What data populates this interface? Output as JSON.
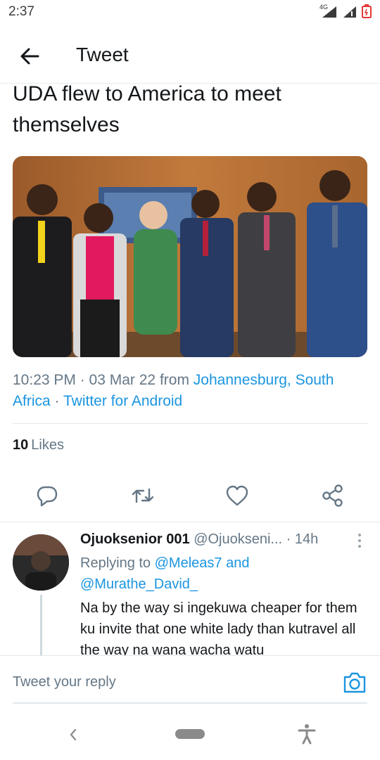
{
  "status_bar": {
    "time": "2:37",
    "network": "4G"
  },
  "header": {
    "title": "Tweet"
  },
  "tweet": {
    "text": "UDA flew to America to meet themselves",
    "timestamp": "10:23 PM · 03 Mar 22",
    "from_word": "from",
    "location": "Johannesburg, South Africa",
    "separator": "·",
    "client": "Twitter for Android",
    "likes_count": "10",
    "likes_label": "Likes"
  },
  "actions": [
    "reply-icon",
    "retweet-icon",
    "like-icon",
    "share-icon"
  ],
  "reply": {
    "name": "Ojuoksenior 001",
    "handle": "@Ojuokseni...",
    "time": "· 14h",
    "replying_to_label": "Replying to",
    "mention_1": "@Meleas7",
    "and_word": "and",
    "mention_2": "@Murathe_David_",
    "body": "Na by the way si ingekuwa cheaper for them ku invite that one white lady than kutravel all the way na wana wacha watu"
  },
  "composer": {
    "placeholder": "Tweet your reply"
  },
  "colors": {
    "accent": "#1b95e0",
    "secondary_text": "#657786",
    "primary_text": "#14171a"
  }
}
